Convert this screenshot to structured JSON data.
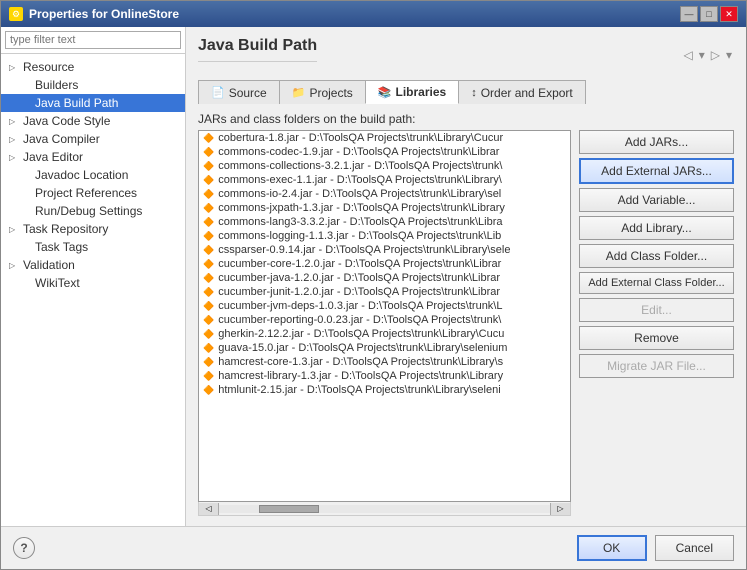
{
  "window": {
    "title": "Properties for OnlineStore"
  },
  "titleButtons": {
    "minimize": "—",
    "maximize": "□",
    "close": "✕"
  },
  "filter": {
    "placeholder": "type filter text"
  },
  "tree": {
    "items": [
      {
        "label": "Resource",
        "indent": false,
        "hasArrow": true,
        "expanded": false
      },
      {
        "label": "Builders",
        "indent": true,
        "hasArrow": false
      },
      {
        "label": "Java Build Path",
        "indent": true,
        "hasArrow": false,
        "selected": true
      },
      {
        "label": "Java Code Style",
        "indent": false,
        "hasArrow": true
      },
      {
        "label": "Java Compiler",
        "indent": false,
        "hasArrow": true
      },
      {
        "label": "Java Editor",
        "indent": false,
        "hasArrow": true
      },
      {
        "label": "Javadoc Location",
        "indent": true,
        "hasArrow": false
      },
      {
        "label": "Project References",
        "indent": true,
        "hasArrow": false
      },
      {
        "label": "Run/Debug Settings",
        "indent": true,
        "hasArrow": false
      },
      {
        "label": "Task Repository",
        "indent": false,
        "hasArrow": true
      },
      {
        "label": "Task Tags",
        "indent": true,
        "hasArrow": false
      },
      {
        "label": "Validation",
        "indent": false,
        "hasArrow": true
      },
      {
        "label": "WikiText",
        "indent": true,
        "hasArrow": false
      }
    ]
  },
  "panel": {
    "title": "Java Build Path",
    "tabs": [
      {
        "label": "Source",
        "icon": "📄",
        "active": false
      },
      {
        "label": "Projects",
        "icon": "📁",
        "active": false
      },
      {
        "label": "Libraries",
        "icon": "📚",
        "active": true
      },
      {
        "label": "Order and Export",
        "icon": "↕",
        "active": false
      }
    ],
    "jarsLabel": "JARs and class folders on the build path:",
    "listItems": [
      "cobertura-1.8.jar - D:\\ToolsQA Projects\\trunk\\Library\\Cucur",
      "commons-codec-1.9.jar - D:\\ToolsQA Projects\\trunk\\Librar",
      "commons-collections-3.2.1.jar - D:\\ToolsQA Projects\\trunk\\",
      "commons-exec-1.1.jar - D:\\ToolsQA Projects\\trunk\\Library\\",
      "commons-io-2.4.jar - D:\\ToolsQA Projects\\trunk\\Library\\sel",
      "commons-jxpath-1.3.jar - D:\\ToolsQA Projects\\trunk\\Library",
      "commons-lang3-3.3.2.jar - D:\\ToolsQA Projects\\trunk\\Libra",
      "commons-logging-1.1.3.jar - D:\\ToolsQA Projects\\trunk\\Lib",
      "cssparser-0.9.14.jar - D:\\ToolsQA Projects\\trunk\\Library\\sele",
      "cucumber-core-1.2.0.jar - D:\\ToolsQA Projects\\trunk\\Librar",
      "cucumber-java-1.2.0.jar - D:\\ToolsQA Projects\\trunk\\Librar",
      "cucumber-junit-1.2.0.jar - D:\\ToolsQA Projects\\trunk\\Librar",
      "cucumber-jvm-deps-1.0.3.jar - D:\\ToolsQA Projects\\trunk\\L",
      "cucumber-reporting-0.0.23.jar - D:\\ToolsQA Projects\\trunk\\",
      "gherkin-2.12.2.jar - D:\\ToolsQA Projects\\trunk\\Library\\Cucu",
      "guava-15.0.jar - D:\\ToolsQA Projects\\trunk\\Library\\selenium",
      "hamcrest-core-1.3.jar - D:\\ToolsQA Projects\\trunk\\Library\\s",
      "hamcrest-library-1.3.jar - D:\\ToolsQA Projects\\trunk\\Library",
      "htmlunit-2.15.jar - D:\\ToolsQA Projects\\trunk\\Library\\seleni"
    ],
    "buttons": [
      {
        "label": "Add JARs...",
        "disabled": false,
        "highlighted": false
      },
      {
        "label": "Add External JARs...",
        "disabled": false,
        "highlighted": true
      },
      {
        "label": "Add Variable...",
        "disabled": false,
        "highlighted": false
      },
      {
        "label": "Add Library...",
        "disabled": false,
        "highlighted": false
      },
      {
        "label": "Add Class Folder...",
        "disabled": false,
        "highlighted": false
      },
      {
        "label": "Add External Class Folder...",
        "disabled": false,
        "highlighted": false
      },
      {
        "label": "Edit...",
        "disabled": true,
        "highlighted": false
      },
      {
        "label": "Remove",
        "disabled": false,
        "highlighted": false
      },
      {
        "label": "Migrate JAR File...",
        "disabled": true,
        "highlighted": false
      }
    ]
  },
  "footer": {
    "help": "?",
    "ok": "OK",
    "cancel": "Cancel"
  }
}
